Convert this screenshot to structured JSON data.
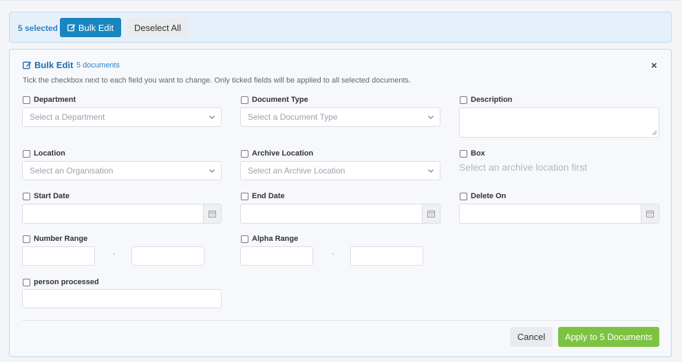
{
  "selection_bar": {
    "count_label": "5 selected",
    "bulk_edit_label": "Bulk Edit",
    "deselect_all_label": "Deselect All"
  },
  "panel": {
    "title": "Bulk Edit",
    "subtitle": "5 documents",
    "close_label": "×",
    "hint": "Tick the checkbox next to each field you want to change. Only ticked fields will be applied to all selected documents."
  },
  "fields": {
    "department": {
      "label": "Department",
      "placeholder": "Select a Department"
    },
    "document_type": {
      "label": "Document Type",
      "placeholder": "Select a Document Type"
    },
    "description": {
      "label": "Description"
    },
    "location": {
      "label": "Location",
      "placeholder": "Select an Organisation"
    },
    "archive_location": {
      "label": "Archive Location",
      "placeholder": "Select an Archive Location"
    },
    "box": {
      "label": "Box",
      "note": "Select an archive location first"
    },
    "start_date": {
      "label": "Start Date"
    },
    "end_date": {
      "label": "End Date"
    },
    "delete_on": {
      "label": "Delete On"
    },
    "number_range": {
      "label": "Number Range",
      "separator": "-"
    },
    "alpha_range": {
      "label": "Alpha Range",
      "separator": "-"
    },
    "person_processed": {
      "label": "person processed"
    }
  },
  "footer": {
    "cancel_label": "Cancel",
    "apply_label": "Apply to 5 Documents"
  },
  "colors": {
    "primary": "#1a86c0",
    "success": "#7dc242",
    "accent_text": "#2f80c7"
  }
}
